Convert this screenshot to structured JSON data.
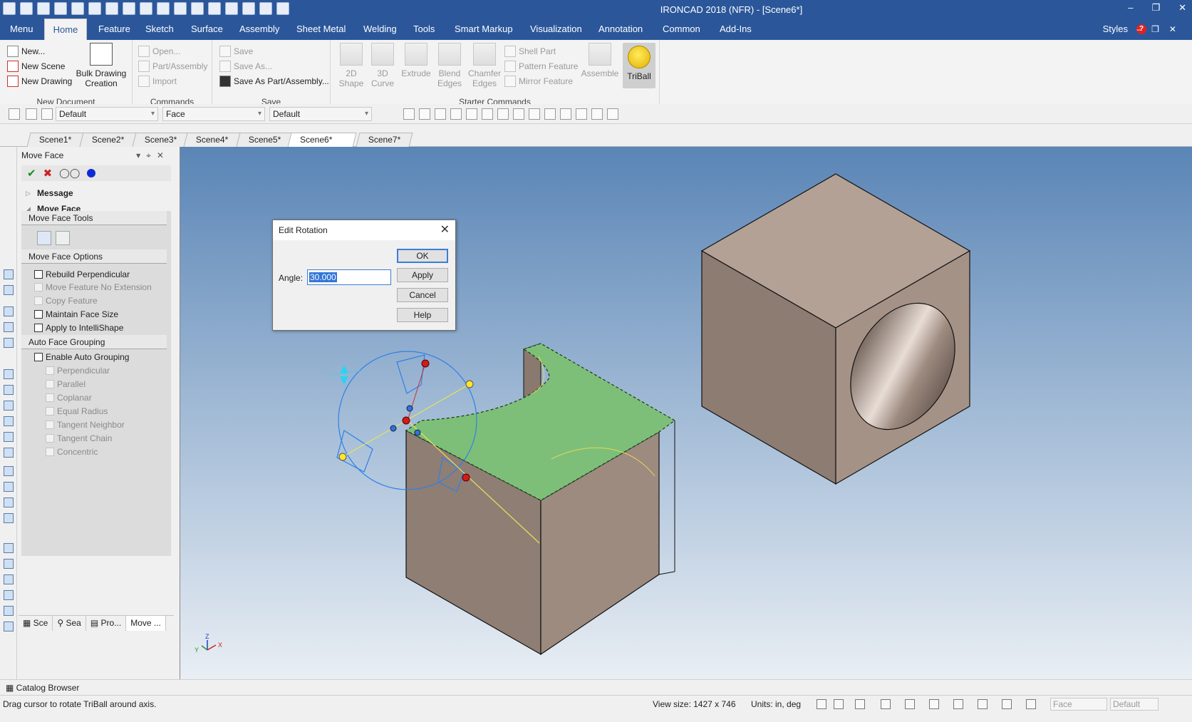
{
  "window": {
    "title": "IRONCAD 2018 (NFR) - [Scene6*]"
  },
  "ribbon": {
    "tabs": [
      "Menu",
      "Home",
      "Feature",
      "Sketch",
      "Surface",
      "Assembly",
      "Sheet Metal",
      "Welding",
      "Tools",
      "Smart Markup",
      "Visualization",
      "Annotation",
      "Common",
      "Add-Ins"
    ],
    "active_tab": "Home",
    "styles_label": "Styles",
    "groups": {
      "new_document": {
        "name": "New Document",
        "new": "New...",
        "new_scene": "New Scene",
        "new_drawing": "New Drawing",
        "bulk_line1": "Bulk Drawing",
        "bulk_line2": "Creation"
      },
      "commands": {
        "name": "Commands",
        "open": "Open...",
        "part_assembly": "Part/Assembly",
        "import": "Import"
      },
      "save": {
        "name": "Save",
        "save": "Save",
        "save_as": "Save As...",
        "save_as_part": "Save As Part/Assembly..."
      },
      "starter": {
        "name": "Starter Commands",
        "shape_2d_1": "2D",
        "shape_2d_2": "Shape",
        "curve_3d_1": "3D",
        "curve_3d_2": "Curve",
        "extrude": "Extrude",
        "blend_1": "Blend",
        "blend_2": "Edges",
        "chamfer_1": "Chamfer",
        "chamfer_2": "Edges",
        "shell_part": "Shell Part",
        "pattern_feature": "Pattern Feature",
        "mirror_feature": "Mirror Feature",
        "assemble": "Assemble",
        "triball": "TriBall"
      }
    }
  },
  "toolbar2": {
    "combo1": "Default",
    "combo2": "Face",
    "combo3": "Default"
  },
  "scene_tabs": [
    "Scene1*",
    "Scene2*",
    "Scene3*",
    "Scene4*",
    "Scene5*",
    "Scene6*",
    "Scene7*"
  ],
  "active_scene": "Scene6*",
  "panel": {
    "title": "Move Face",
    "sections": {
      "message": "Message",
      "move_face": "Move Face"
    },
    "tools_heading": "Move Face Tools",
    "options_heading": "Move Face Options",
    "options": {
      "rebuild_perpendicular": "Rebuild Perpendicular",
      "move_feature_no_extension": "Move Feature No Extension",
      "copy_feature": "Copy Feature",
      "maintain_face_size": "Maintain Face Size",
      "apply_to_intellishape": "Apply to IntelliShape"
    },
    "auto_heading": "Auto Face Grouping",
    "auto": {
      "enable": "Enable Auto Grouping",
      "perpendicular": "Perpendicular",
      "parallel": "Parallel",
      "coplanar": "Coplanar",
      "equal_radius": "Equal Radius",
      "tangent_neighbor": "Tangent Neighbor",
      "tangent_chain": "Tangent Chain",
      "concentric": "Concentric"
    },
    "bottom_tabs": [
      "Sce",
      "Sea",
      "Pro...",
      "Move ..."
    ]
  },
  "catalog_browser": "Catalog Browser",
  "dialog": {
    "title": "Edit Rotation",
    "angle_label": "Angle:",
    "angle_value": "30.000",
    "ok": "OK",
    "apply": "Apply",
    "cancel": "Cancel",
    "help": "Help"
  },
  "viewport": {
    "axis_labels": {
      "z": "Z",
      "y": "Y",
      "x": "X"
    }
  },
  "status": {
    "message": "Drag cursor to rotate TriBall around axis.",
    "view_size": "View size: 1427 x  746",
    "units": "Units: in, deg",
    "combo_face": "Face",
    "combo_default": "Default"
  },
  "colors": {
    "title_blue": "#2b579a",
    "selected_face": "#7dbf79",
    "part_face": "#a89284",
    "triball": "#2f80e6"
  }
}
